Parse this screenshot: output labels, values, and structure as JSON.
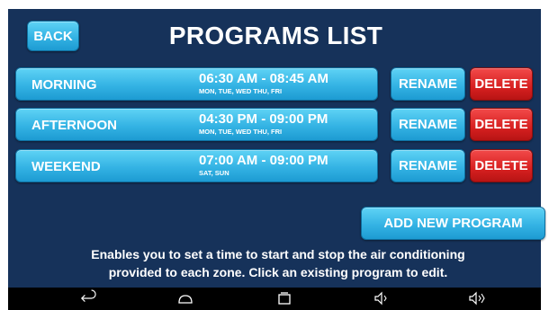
{
  "header": {
    "back_label": "BACK",
    "title": "PROGRAMS LIST"
  },
  "programs": [
    {
      "name": "MORNING",
      "time": "06:30 AM - 08:45 AM",
      "days": "MON, TUE, WED THU, FRI",
      "rename_label": "RENAME",
      "delete_label": "DELETE"
    },
    {
      "name": "AFTERNOON",
      "time": "04:30 PM - 09:00 PM",
      "days": "MON, TUE, WED THU, FRI",
      "rename_label": "RENAME",
      "delete_label": "DELETE"
    },
    {
      "name": "WEEKEND",
      "time": "07:00 AM - 09:00 PM",
      "days": "SAT, SUN",
      "rename_label": "RENAME",
      "delete_label": "DELETE"
    }
  ],
  "actions": {
    "add_label": "ADD NEW PROGRAM"
  },
  "description": {
    "line1": "Enables you to set a time to start and stop the air conditioning",
    "line2": "provided to each zone. Click an existing program to edit."
  },
  "navbar": {
    "icons": [
      "back-icon",
      "home-icon",
      "recent-apps-icon",
      "volume-down-icon",
      "volume-up-icon"
    ]
  },
  "colors": {
    "background": "#16325a",
    "button_blue": "#34b3e4",
    "button_red": "#d72020",
    "navbar": "#000000"
  }
}
